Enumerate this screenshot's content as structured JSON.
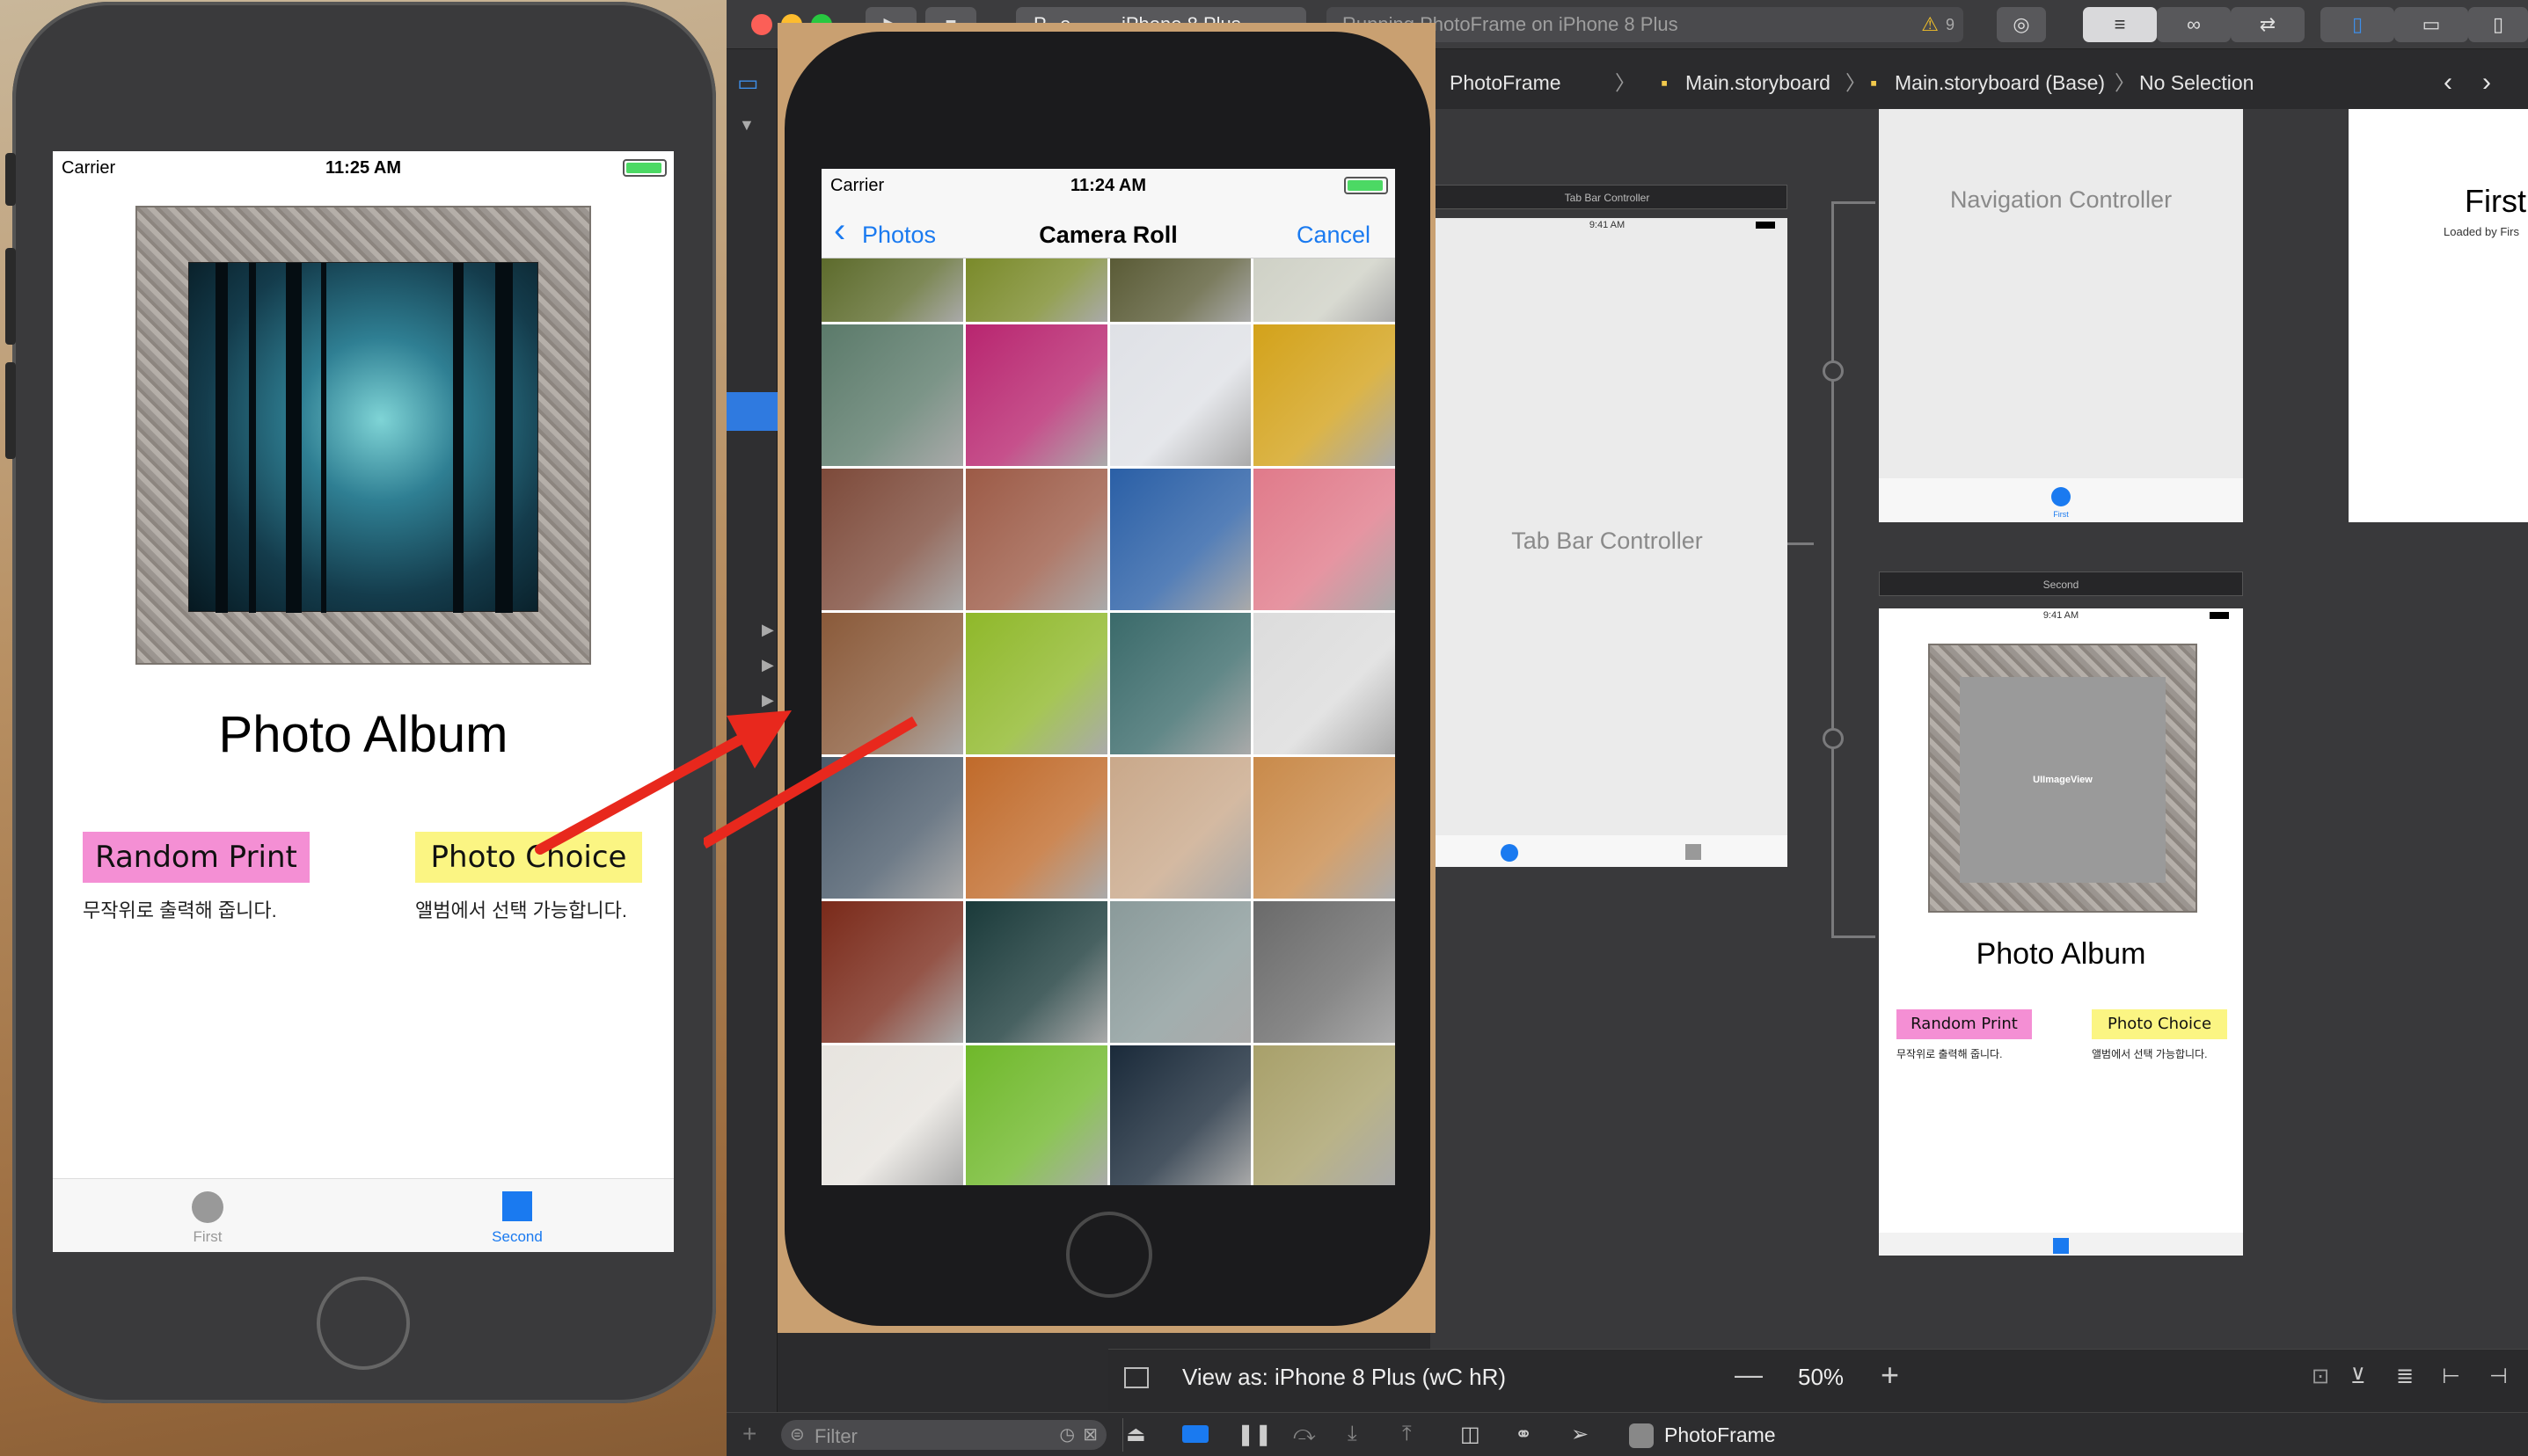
{
  "phone1": {
    "status": {
      "carrier": "Carrier",
      "time": "11:25 AM"
    },
    "title": "Photo Album",
    "random_button": "Random Print",
    "random_desc": "무작위로 출력해 줍니다.",
    "choice_button": "Photo Choice",
    "choice_desc": "앨범에서 선택 가능합니다.",
    "tabs": [
      {
        "label": "First"
      },
      {
        "label": "Second"
      }
    ]
  },
  "xcode": {
    "scheme_target": "P...e",
    "scheme_device": "iPhone 8 Plus",
    "activity": "Running PhotoFrame on iPhone 8 Plus",
    "warnings": "9",
    "breadcrumb": [
      "PhotoFrame",
      "Main.storyboard",
      "Main.storyboard (Base)",
      "No Selection"
    ],
    "view_as": "View as: iPhone 8 Plus (wC hR)",
    "zoom": "50%",
    "filter_placeholder": "Filter",
    "scheme_bottom": "PhotoFrame"
  },
  "storyboard": {
    "tab_bar_header": "Tab Bar Controller",
    "tab_bar_time": "9:41 AM",
    "tab_bar_label": "Tab Bar Controller",
    "nav_label": "Navigation Controller",
    "nav_tab": "First",
    "first_title": "First",
    "first_sub": "Loaded by Firs",
    "second_header": "Second",
    "second_time": "9:41 AM",
    "imageview_label": "UIImageView",
    "second_title": "Photo Album",
    "second_random": "Random Print",
    "second_random_desc": "무작위로 출력해 줍니다.",
    "second_choice": "Photo Choice",
    "second_choice_desc": "앨범에서 선택 가능합니다."
  },
  "phone2": {
    "status": {
      "carrier": "Carrier",
      "time": "11:24 AM"
    },
    "back": "Photos",
    "title": "Camera Roll",
    "cancel": "Cancel",
    "photo_colors": [
      "#5d6b2c",
      "#7a8a2a",
      "#5a5b36",
      "#cfd1c6",
      "#5b7a6a",
      "#b8256f",
      "#dfe1e6",
      "#d3a21a",
      "#7d4a3a",
      "#9c5a46",
      "#2a5fa6",
      "#e07a8a",
      "#8a5a3a",
      "#8fb82a",
      "#3a6a6a",
      "#dcdcdc",
      "#4a5a6a",
      "#c06a2a",
      "#c9a88a",
      "#c98a4a",
      "#7a2a1a",
      "#1a3a3a",
      "#8a9a9a",
      "#6a6a6a",
      "#e7e4df",
      "#6fb82a",
      "#1a2a3a",
      "#a8a06a"
    ]
  },
  "colors": {
    "accent": "#1a7af0",
    "pink": "#f48fd4",
    "yellow": "#fbf583",
    "arrow": "#e8281d"
  }
}
